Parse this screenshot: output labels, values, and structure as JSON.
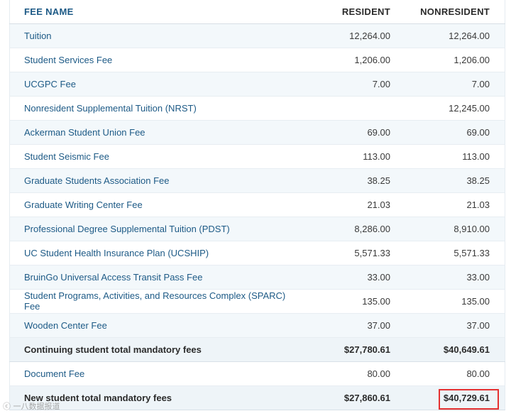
{
  "table": {
    "headers": {
      "name": "FEE NAME",
      "resident": "RESIDENT",
      "nonresident": "NONRESIDENT"
    },
    "rows": [
      {
        "name": "Tuition",
        "resident": "12,264.00",
        "nonresident": "12,264.00"
      },
      {
        "name": "Student Services Fee",
        "resident": "1,206.00",
        "nonresident": "1,206.00"
      },
      {
        "name": "UCGPC Fee",
        "resident": "7.00",
        "nonresident": "7.00"
      },
      {
        "name": "Nonresident Supplemental Tuition (NRST)",
        "resident": "",
        "nonresident": "12,245.00"
      },
      {
        "name": "Ackerman Student Union Fee",
        "resident": "69.00",
        "nonresident": "69.00"
      },
      {
        "name": "Student Seismic Fee",
        "resident": "113.00",
        "nonresident": "113.00"
      },
      {
        "name": "Graduate Students Association Fee",
        "resident": "38.25",
        "nonresident": "38.25"
      },
      {
        "name": "Graduate Writing Center Fee",
        "resident": "21.03",
        "nonresident": "21.03"
      },
      {
        "name": "Professional Degree Supplemental Tuition (PDST)",
        "resident": "8,286.00",
        "nonresident": "8,910.00"
      },
      {
        "name": "UC Student Health Insurance Plan (UCSHIP)",
        "resident": "5,571.33",
        "nonresident": "5,571.33"
      },
      {
        "name": "BruinGo Universal Access Transit Pass Fee",
        "resident": "33.00",
        "nonresident": "33.00"
      },
      {
        "name": "Student Programs, Activities, and Resources Complex (SPARC) Fee",
        "resident": "135.00",
        "nonresident": "135.00"
      },
      {
        "name": "Wooden Center Fee",
        "resident": "37.00",
        "nonresident": "37.00"
      }
    ],
    "continuing_total": {
      "name": "Continuing student total mandatory fees",
      "resident": "$27,780.61",
      "nonresident": "$40,649.61"
    },
    "document_fee": {
      "name": "Document Fee",
      "resident": "80.00",
      "nonresident": "80.00"
    },
    "new_total": {
      "name": "New student total mandatory fees",
      "resident": "$27,860.61",
      "nonresident": "$40,729.61"
    }
  },
  "watermark": {
    "text": "ⓒ 一八数据报道"
  },
  "colors": {
    "link": "#1d5a86",
    "stripe": "#f3f8fb",
    "highlight": "#e53131"
  }
}
